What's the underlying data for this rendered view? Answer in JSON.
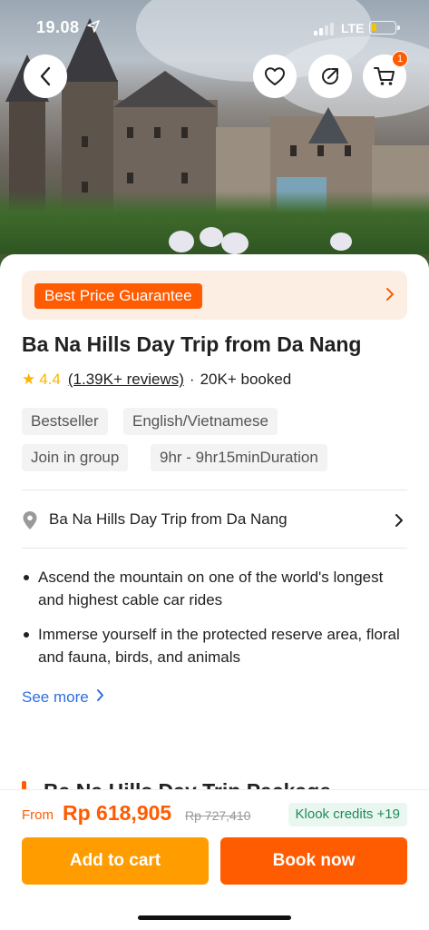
{
  "status_bar": {
    "time": "19.08",
    "network": "LTE",
    "battery_level": 0.2,
    "battery_color": "#f5c400"
  },
  "header": {
    "back_icon": "chevron-left-icon",
    "wishlist_icon": "heart-icon",
    "share_icon": "share-icon",
    "cart_icon": "cart-icon",
    "cart_count": "1"
  },
  "banner": {
    "label": "Best Price Guarantee",
    "chevron_icon": "chevron-right-icon"
  },
  "product": {
    "title": "Ba Na Hills Day Trip from Da Nang",
    "rating": "4.4",
    "reviews": "(1.39K+ reviews)",
    "separator": "·",
    "booked": "20K+ booked",
    "tags": [
      "Bestseller",
      "English/Vietnamese",
      "Join in group",
      "9hr - 9hr15minDuration"
    ]
  },
  "location": {
    "text": "Ba Na Hills Day Trip from Da Nang",
    "icon": "map-pin-icon"
  },
  "highlights": [
    "Ascend the mountain on one of the world's longest and highest cable car rides",
    "Immerse yourself in the protected reserve area, floral and fauna, birds, and animals"
  ],
  "see_more": "See more",
  "next_section_title": "Ba Na Hills Day Trip Package",
  "pricing": {
    "from_label": "From",
    "price": "Rp 618,905",
    "original_price": "Rp 727,410",
    "credits": "Klook credits +19"
  },
  "actions": {
    "add_to_cart": "Add to cart",
    "book_now": "Book now"
  },
  "colors": {
    "brand_orange": "#ff5b00",
    "cart_orange": "#ff9c00",
    "banner_bg": "#fdeee4",
    "link_blue": "#2f6fde",
    "star_yellow": "#ffb400",
    "credits_green": "#1f8a5a"
  }
}
